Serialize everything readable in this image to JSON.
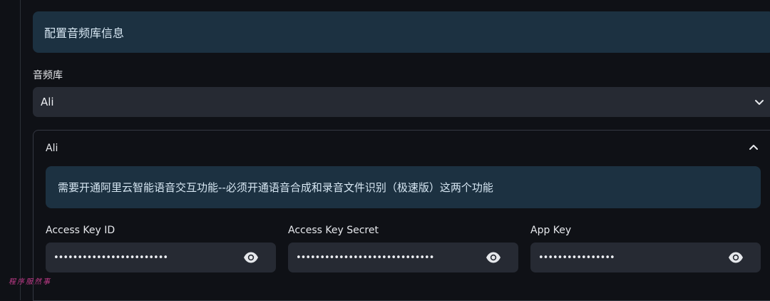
{
  "banner": {
    "text": "配置音频库信息"
  },
  "select": {
    "label": "音频库",
    "value": "Ali",
    "chevron_icon": "chevron-down-icon"
  },
  "expander": {
    "title": "Ali",
    "chevron_icon": "chevron-up-icon",
    "notice": "需要开通阿里云智能语音交互功能--必须开通语音合成和录音文件识别（极速版）这两个功能",
    "fields": [
      {
        "label": "Access Key ID",
        "value": "••••••••••••••••••••••••",
        "icon": "eye-icon"
      },
      {
        "label": "Access Key Secret",
        "value": "•••••••••••••••••••••••••••••",
        "icon": "eye-icon"
      },
      {
        "label": "App Key",
        "value": "••••••••••••••••",
        "icon": "eye-icon"
      }
    ]
  },
  "watermark": {
    "text": "程序服然事"
  },
  "colors": {
    "background": "#0f1116",
    "info_banner": "#1c3141",
    "input": "#262a33",
    "watermark": "#c23b8a"
  }
}
